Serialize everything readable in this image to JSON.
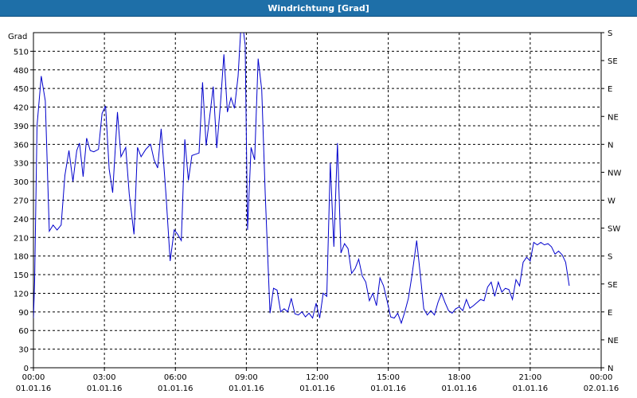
{
  "window": {
    "title": "Windrichtung [Grad]"
  },
  "chart_data": {
    "type": "line",
    "title": "Windrichtung [Grad]",
    "ylabel": "Grad",
    "y2label": "",
    "ylim": [
      0,
      540
    ],
    "xlim_hours": [
      0,
      24
    ],
    "grid": true,
    "line_color": "#0000cc",
    "y_ticks": [
      0,
      30,
      60,
      90,
      120,
      150,
      180,
      210,
      240,
      270,
      300,
      330,
      360,
      390,
      420,
      450,
      480,
      510
    ],
    "y2_ticks": [
      {
        "value": 0,
        "label": "N"
      },
      {
        "value": 45,
        "label": "NE"
      },
      {
        "value": 90,
        "label": "E"
      },
      {
        "value": 135,
        "label": "SE"
      },
      {
        "value": 180,
        "label": "S"
      },
      {
        "value": 225,
        "label": "SW"
      },
      {
        "value": 270,
        "label": "W"
      },
      {
        "value": 315,
        "label": "NW"
      },
      {
        "value": 360,
        "label": "N"
      },
      {
        "value": 405,
        "label": "NE"
      },
      {
        "value": 450,
        "label": "E"
      },
      {
        "value": 495,
        "label": "SE"
      },
      {
        "value": 540,
        "label": "S"
      }
    ],
    "x_ticks": [
      {
        "hour": 0,
        "time": "00:00",
        "date": "01.01.16"
      },
      {
        "hour": 3,
        "time": "03:00",
        "date": "01.01.16"
      },
      {
        "hour": 6,
        "time": "06:00",
        "date": "01.01.16"
      },
      {
        "hour": 9,
        "time": "09:00",
        "date": "01.01.16"
      },
      {
        "hour": 12,
        "time": "12:00",
        "date": "01.01.16"
      },
      {
        "hour": 15,
        "time": "15:00",
        "date": "01.01.16"
      },
      {
        "hour": 18,
        "time": "18:00",
        "date": "01.01.16"
      },
      {
        "hour": 21,
        "time": "21:00",
        "date": "01.01.16"
      },
      {
        "hour": 24,
        "time": "00:00",
        "date": "02.01.16"
      }
    ],
    "series": [
      {
        "points": [
          [
            0.0,
            80
          ],
          [
            0.05,
            140
          ],
          [
            0.15,
            390
          ],
          [
            0.33,
            470
          ],
          [
            0.5,
            430
          ],
          [
            0.67,
            220
          ],
          [
            0.83,
            230
          ],
          [
            1.0,
            222
          ],
          [
            1.17,
            230
          ],
          [
            1.33,
            310
          ],
          [
            1.5,
            350
          ],
          [
            1.67,
            300
          ],
          [
            1.83,
            350
          ],
          [
            1.95,
            362
          ],
          [
            2.1,
            308
          ],
          [
            2.25,
            370
          ],
          [
            2.4,
            350
          ],
          [
            2.55,
            348
          ],
          [
            2.75,
            352
          ],
          [
            2.9,
            410
          ],
          [
            3.05,
            422
          ],
          [
            3.2,
            320
          ],
          [
            3.35,
            282
          ],
          [
            3.55,
            412
          ],
          [
            3.7,
            340
          ],
          [
            3.9,
            355
          ],
          [
            4.05,
            280
          ],
          [
            4.25,
            215
          ],
          [
            4.4,
            355
          ],
          [
            4.55,
            340
          ],
          [
            4.75,
            352
          ],
          [
            4.95,
            360
          ],
          [
            5.1,
            335
          ],
          [
            5.25,
            322
          ],
          [
            5.4,
            385
          ],
          [
            5.6,
            280
          ],
          [
            5.78,
            172
          ],
          [
            5.95,
            222
          ],
          [
            6.1,
            215
          ],
          [
            6.25,
            205
          ],
          [
            6.4,
            368
          ],
          [
            6.55,
            302
          ],
          [
            6.7,
            342
          ],
          [
            6.85,
            344
          ],
          [
            7.0,
            346
          ],
          [
            7.15,
            460
          ],
          [
            7.3,
            358
          ],
          [
            7.45,
            404
          ],
          [
            7.6,
            453
          ],
          [
            7.75,
            354
          ],
          [
            7.9,
            422
          ],
          [
            8.05,
            505
          ],
          [
            8.2,
            412
          ],
          [
            8.35,
            435
          ],
          [
            8.5,
            418
          ],
          [
            8.65,
            470
          ],
          [
            8.8,
            568
          ],
          [
            8.95,
            520
          ],
          [
            9.05,
            222
          ],
          [
            9.2,
            355
          ],
          [
            9.35,
            335
          ],
          [
            9.5,
            498
          ],
          [
            9.65,
            448
          ],
          [
            9.8,
            280
          ],
          [
            10.0,
            88
          ],
          [
            10.15,
            128
          ],
          [
            10.3,
            125
          ],
          [
            10.45,
            90
          ],
          [
            10.6,
            95
          ],
          [
            10.75,
            90
          ],
          [
            10.9,
            112
          ],
          [
            11.05,
            87
          ],
          [
            11.2,
            85
          ],
          [
            11.35,
            90
          ],
          [
            11.5,
            82
          ],
          [
            11.65,
            88
          ],
          [
            11.8,
            80
          ],
          [
            11.95,
            104
          ],
          [
            12.1,
            80
          ],
          [
            12.25,
            120
          ],
          [
            12.4,
            115
          ],
          [
            12.55,
            330
          ],
          [
            12.7,
            195
          ],
          [
            12.85,
            362
          ],
          [
            13.0,
            185
          ],
          [
            13.15,
            200
          ],
          [
            13.3,
            192
          ],
          [
            13.45,
            152
          ],
          [
            13.6,
            160
          ],
          [
            13.75,
            175
          ],
          [
            13.9,
            148
          ],
          [
            14.05,
            138
          ],
          [
            14.2,
            108
          ],
          [
            14.35,
            120
          ],
          [
            14.5,
            100
          ],
          [
            14.65,
            145
          ],
          [
            14.8,
            132
          ],
          [
            14.95,
            108
          ],
          [
            15.1,
            82
          ],
          [
            15.25,
            80
          ],
          [
            15.4,
            88
          ],
          [
            15.55,
            72
          ],
          [
            15.7,
            90
          ],
          [
            15.85,
            112
          ],
          [
            16.0,
            148
          ],
          [
            16.2,
            205
          ],
          [
            16.35,
            152
          ],
          [
            16.5,
            95
          ],
          [
            16.65,
            85
          ],
          [
            16.8,
            92
          ],
          [
            16.95,
            85
          ],
          [
            17.1,
            105
          ],
          [
            17.25,
            120
          ],
          [
            17.4,
            105
          ],
          [
            17.55,
            92
          ],
          [
            17.7,
            88
          ],
          [
            17.85,
            95
          ],
          [
            18.0,
            98
          ],
          [
            18.15,
            92
          ],
          [
            18.3,
            110
          ],
          [
            18.45,
            96
          ],
          [
            18.6,
            100
          ],
          [
            18.75,
            105
          ],
          [
            18.9,
            110
          ],
          [
            19.05,
            108
          ],
          [
            19.2,
            130
          ],
          [
            19.35,
            138
          ],
          [
            19.5,
            115
          ],
          [
            19.65,
            138
          ],
          [
            19.8,
            122
          ],
          [
            19.95,
            128
          ],
          [
            20.1,
            126
          ],
          [
            20.25,
            110
          ],
          [
            20.4,
            142
          ],
          [
            20.55,
            132
          ],
          [
            20.7,
            170
          ],
          [
            20.85,
            178
          ],
          [
            21.0,
            172
          ],
          [
            21.15,
            202
          ],
          [
            21.3,
            198
          ],
          [
            21.45,
            202
          ],
          [
            21.6,
            198
          ],
          [
            21.75,
            200
          ],
          [
            21.9,
            195
          ],
          [
            22.05,
            183
          ],
          [
            22.2,
            188
          ],
          [
            22.35,
            182
          ],
          [
            22.5,
            170
          ],
          [
            22.65,
            132
          ]
        ]
      }
    ]
  }
}
